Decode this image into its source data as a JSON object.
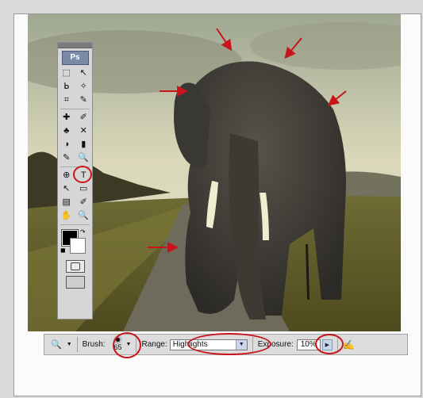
{
  "toolbox": {
    "logo": "Ps",
    "rows": [
      [
        "⬚",
        "↖"
      ],
      [
        "ᖯ",
        "✧"
      ],
      [
        "⌗",
        "✎"
      ],
      [
        "✚",
        "✐"
      ],
      [
        "♣",
        "✕"
      ],
      [
        "◑",
        "▮"
      ],
      [
        "✎",
        "🔍"
      ],
      [
        "⊕",
        "T"
      ],
      [
        "↖",
        "▭"
      ],
      [
        "▤",
        "✐"
      ],
      [
        "✋",
        "🔍"
      ]
    ]
  },
  "options_bar": {
    "brush_label": "Brush:",
    "brush_size": "65",
    "range_label": "Range:",
    "range_value": "Highlights",
    "exposure_label": "Exposure:",
    "exposure_value": "10%"
  },
  "icons": {
    "tool_preset": "dodge-burn-tool-icon",
    "airbrush": "airbrush-icon"
  },
  "colors": {
    "annotation_red": "#c8141a",
    "sky": "#c9c7a3",
    "field": "#6b6a2c"
  }
}
